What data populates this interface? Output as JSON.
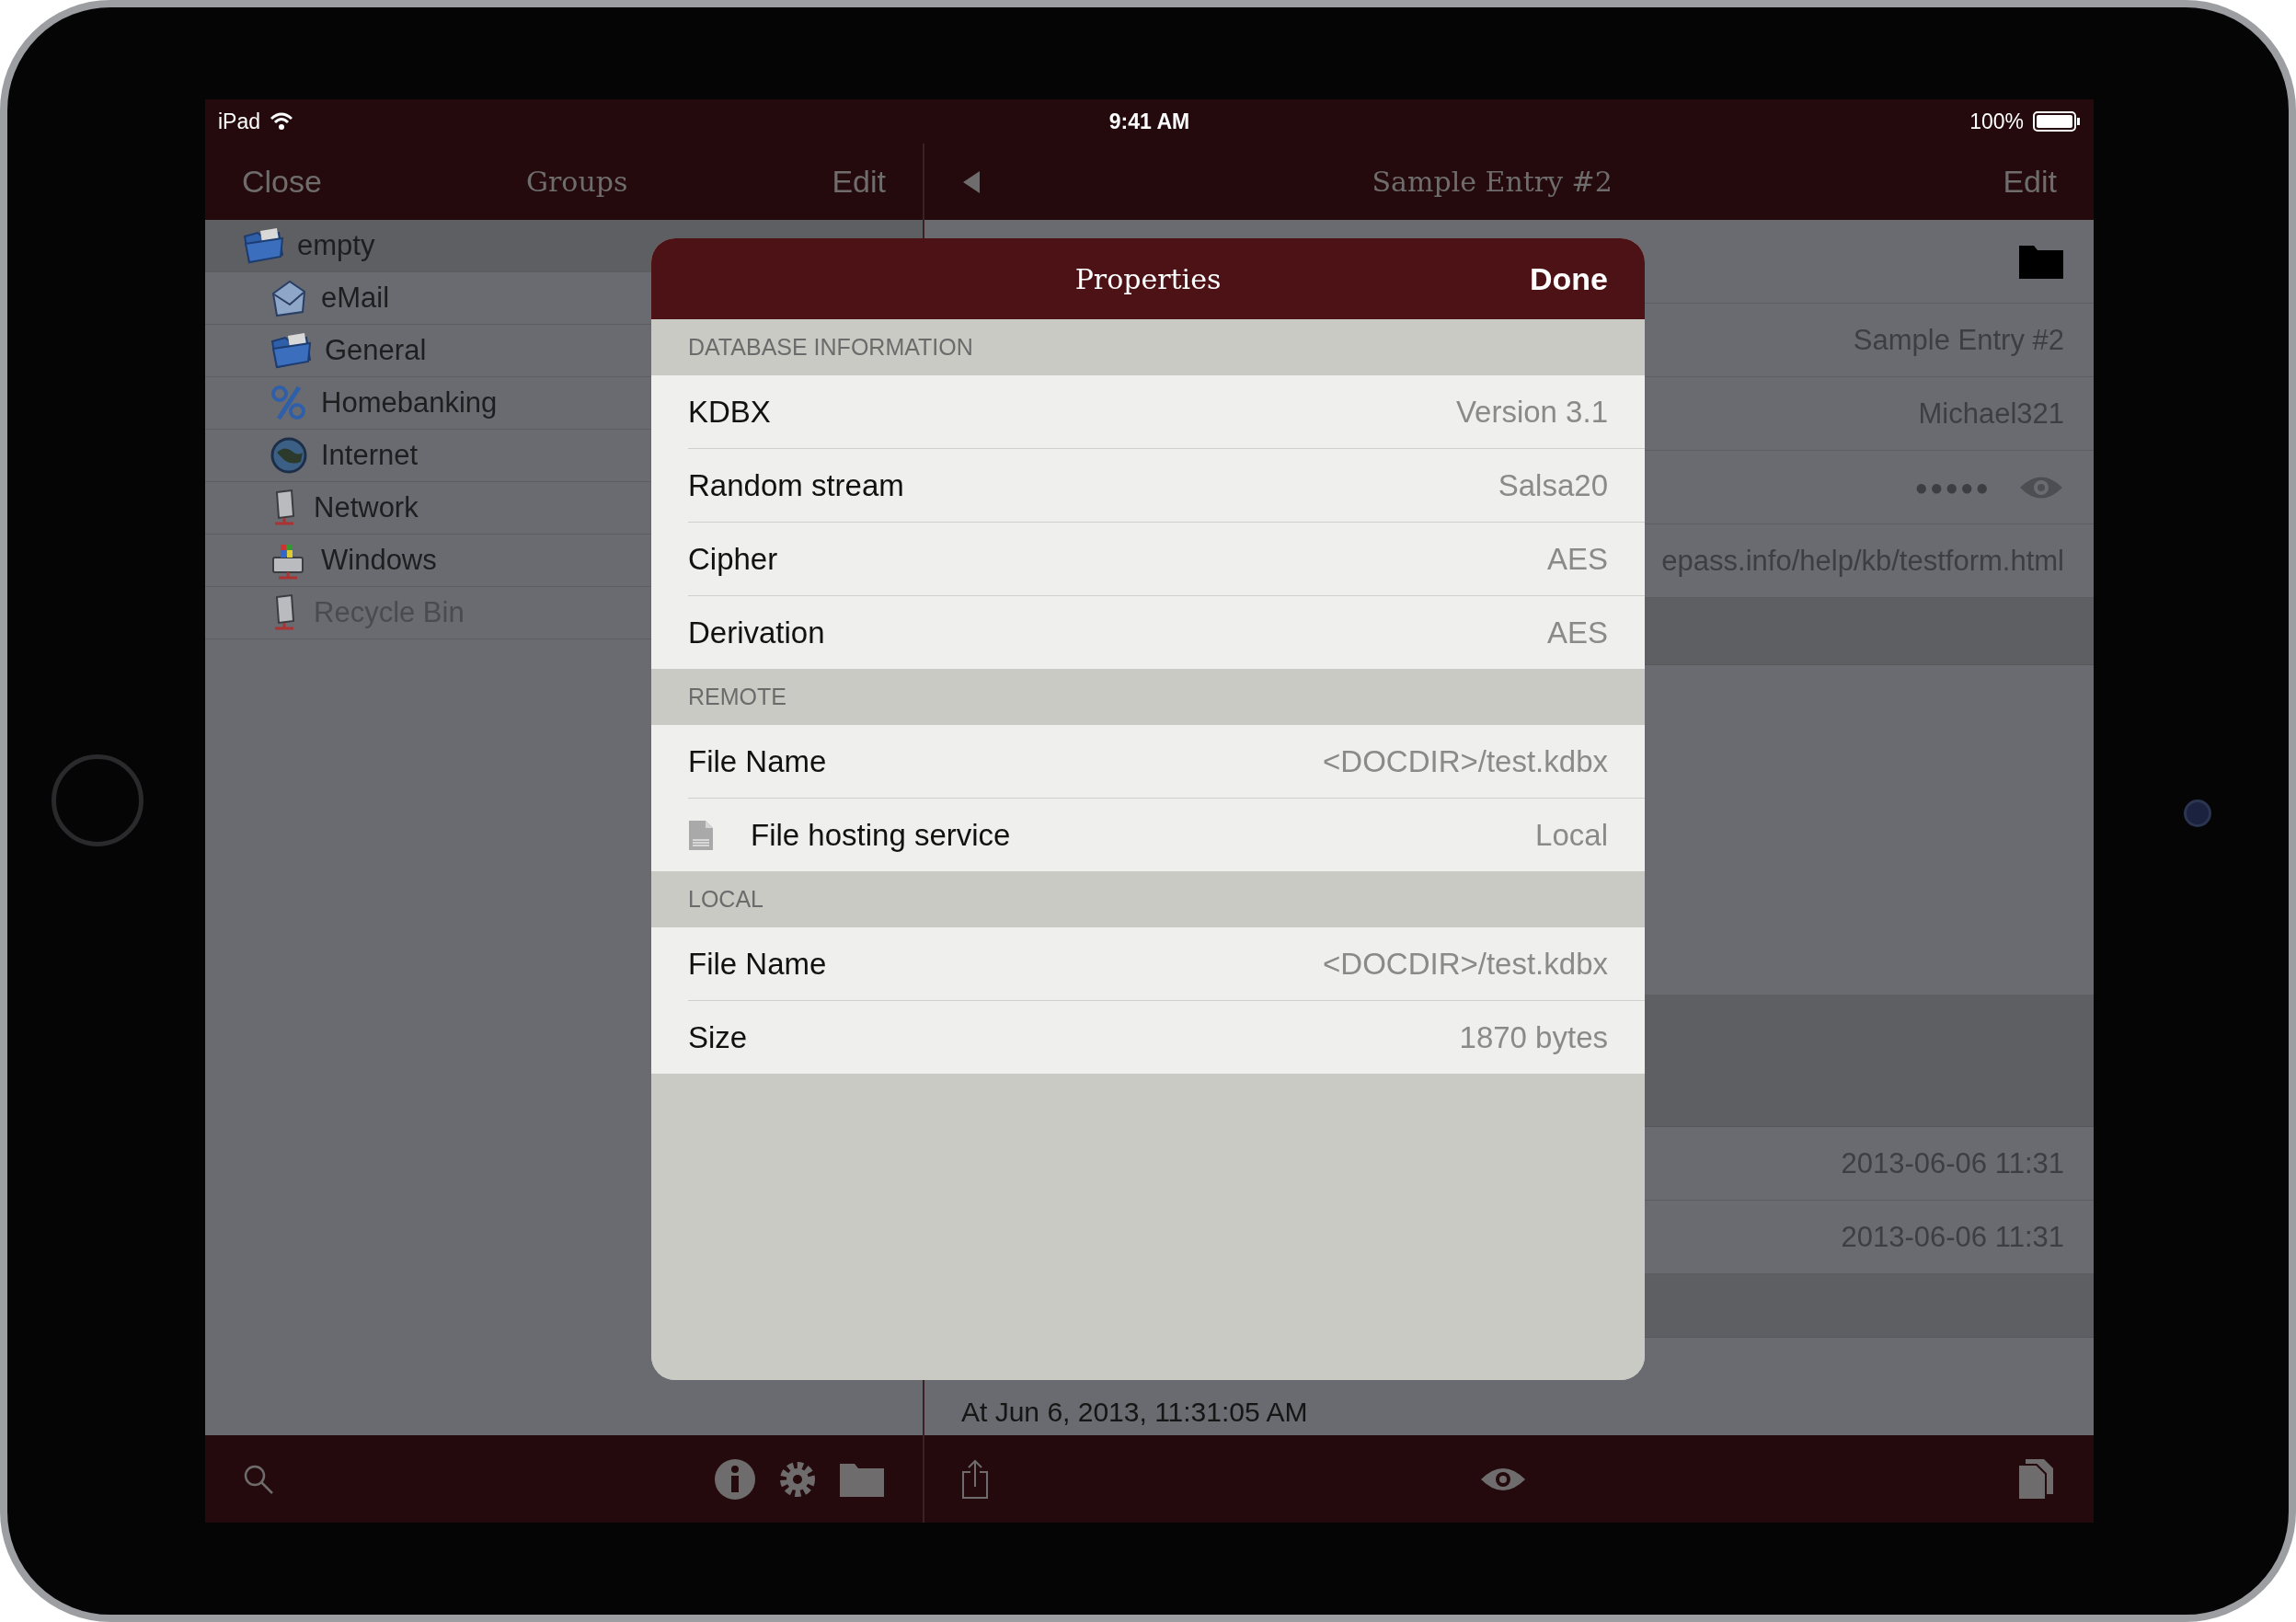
{
  "status_bar": {
    "carrier": "iPad",
    "time": "9:41 AM",
    "battery": "100%"
  },
  "groups_nav": {
    "left": "Close",
    "title": "Groups",
    "right": "Edit"
  },
  "groups": [
    {
      "name": "empty",
      "kind": "folder",
      "selected": true,
      "disabled": false,
      "children": [
        {
          "name": "eMail",
          "kind": "mail",
          "selected": false,
          "disabled": false
        },
        {
          "name": "General",
          "kind": "folder",
          "selected": false,
          "disabled": false
        },
        {
          "name": "Homebanking",
          "kind": "percent",
          "selected": false,
          "disabled": false
        },
        {
          "name": "Internet",
          "kind": "globe",
          "selected": false,
          "disabled": false
        },
        {
          "name": "Network",
          "kind": "server",
          "selected": false,
          "disabled": false
        },
        {
          "name": "Windows",
          "kind": "computer",
          "selected": false,
          "disabled": false
        },
        {
          "name": "Recycle Bin",
          "kind": "server",
          "selected": false,
          "disabled": true
        }
      ]
    }
  ],
  "entry_nav": {
    "title": "Sample Entry #2",
    "right": "Edit"
  },
  "entry": {
    "fields": [
      {
        "kind": "text",
        "value": "Sample Entry #2"
      },
      {
        "kind": "text",
        "value": "Michael321"
      },
      {
        "kind": "password",
        "value": "●●●●●"
      },
      {
        "kind": "text",
        "value": "epass.info/help/kb/testform.html"
      }
    ],
    "dates": [
      "2013-06-06 11:31",
      "2013-06-06 11:31"
    ],
    "footer": "At Jun 6, 2013, 11:31:05 AM"
  },
  "modal": {
    "title": "Properties",
    "done": "Done",
    "sections": [
      {
        "header": "DATABASE INFORMATION",
        "rows": [
          {
            "kind": "plain",
            "label": "KDBX",
            "value": "Version 3.1"
          },
          {
            "kind": "plain",
            "label": "Random stream",
            "value": "Salsa20"
          },
          {
            "kind": "plain",
            "label": "Cipher",
            "value": "AES"
          },
          {
            "kind": "plain",
            "label": "Derivation",
            "value": "AES"
          }
        ]
      },
      {
        "header": "REMOTE",
        "rows": [
          {
            "kind": "plain",
            "label": "File Name",
            "value": "<DOCDIR>/test.kdbx"
          },
          {
            "kind": "file",
            "label": "File hosting service",
            "value": "Local"
          }
        ]
      },
      {
        "header": "LOCAL",
        "rows": [
          {
            "kind": "plain",
            "label": "File Name",
            "value": "<DOCDIR>/test.kdbx"
          },
          {
            "kind": "plain",
            "label": "Size",
            "value": "1870 bytes"
          }
        ]
      }
    ]
  }
}
